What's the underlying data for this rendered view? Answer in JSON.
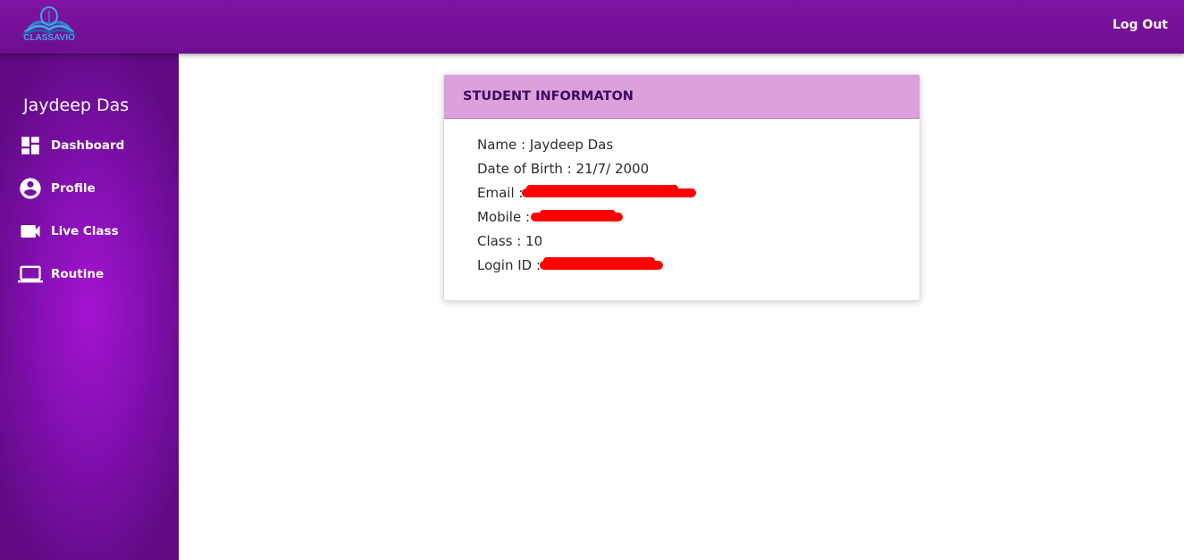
{
  "header": {
    "logo_text": "CLASSAVIO",
    "logout_label": "Log Out"
  },
  "sidebar": {
    "user_name": "Jaydeep Das",
    "items": [
      {
        "label": "Dashboard",
        "icon": "dashboard-icon"
      },
      {
        "label": "Profile",
        "icon": "account-circle-icon"
      },
      {
        "label": "Live Class",
        "icon": "videocam-icon"
      },
      {
        "label": "Routine",
        "icon": "laptop-icon"
      }
    ]
  },
  "card": {
    "title": "STUDENT INFORMATON",
    "rows": [
      {
        "text": "Name : Jaydeep Das",
        "redacted": false
      },
      {
        "text": "Date of Birth : 21/7/ 2000",
        "redacted": false
      },
      {
        "text": "Email :",
        "redacted": true
      },
      {
        "text": "Mobile :",
        "redacted": true
      },
      {
        "text": "Class : 10",
        "redacted": false
      },
      {
        "text": "Login ID :",
        "redacted": true
      }
    ]
  },
  "colors": {
    "topbar": "#7f14a3",
    "sidebar": "#8410b3",
    "card_header": "#dca0dc",
    "card_title": "#3d0a5c",
    "redaction": "#ff0000"
  }
}
